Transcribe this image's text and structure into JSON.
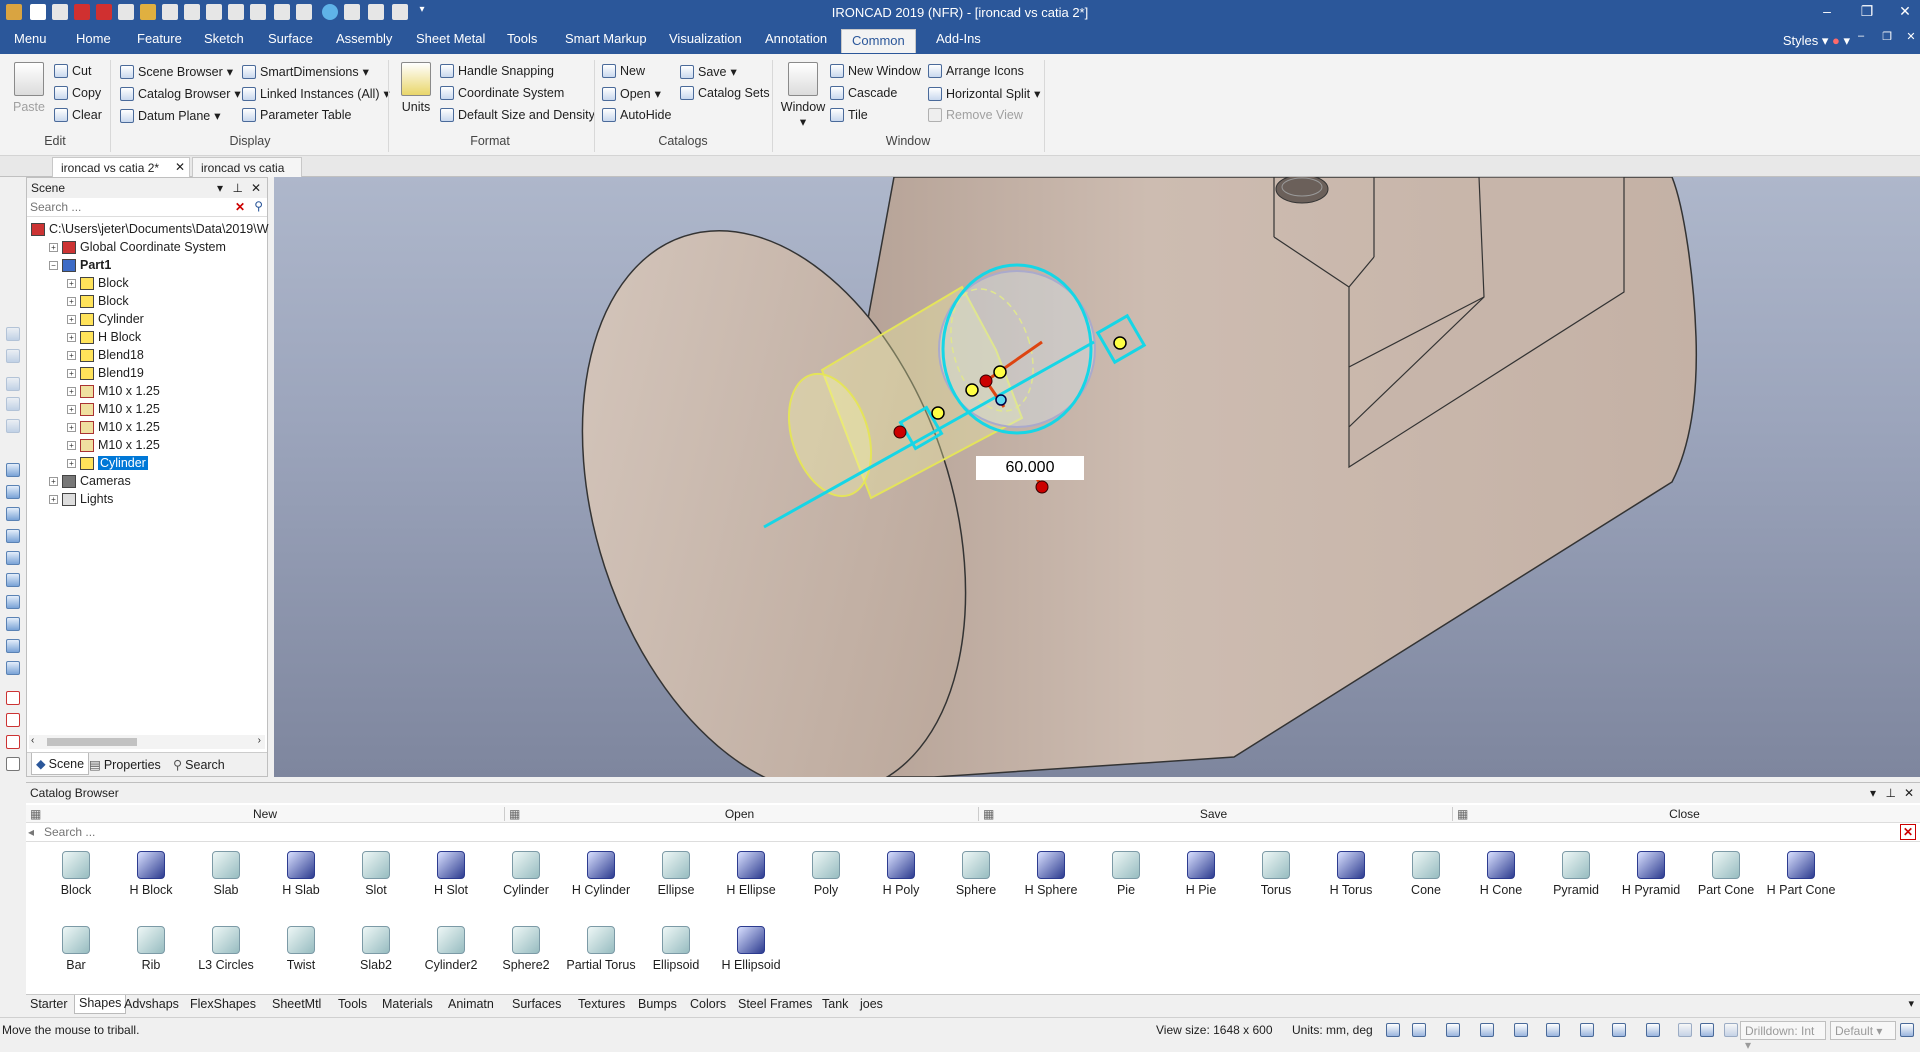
{
  "window": {
    "title": "IRONCAD 2019 (NFR) - [ironcad vs catia 2*]"
  },
  "menu_tabs": [
    "Menu",
    "Home",
    "Feature",
    "Sketch",
    "Surface",
    "Assembly",
    "Sheet Metal",
    "Tools",
    "Smart Markup",
    "Visualization",
    "Annotation",
    "Common",
    "Add-Ins"
  ],
  "active_tab": "Common",
  "styles_label": "Styles",
  "ribbon": {
    "edit": {
      "paste": "Paste",
      "cut": "Cut",
      "copy": "Copy",
      "clear": "Clear",
      "group": "Edit"
    },
    "display": {
      "scene_browser": "Scene Browser",
      "catalog_browser": "Catalog Browser",
      "datum_plane": "Datum Plane",
      "smart_dimensions": "SmartDimensions",
      "linked_instances": "Linked Instances (All)",
      "parameter_table": "Parameter Table",
      "group": "Display"
    },
    "format": {
      "units": "Units",
      "handle_snapping": "Handle Snapping",
      "coordinate_system": "Coordinate System",
      "default_size": "Default Size and Density",
      "group": "Format"
    },
    "catalogs": {
      "new": "New",
      "open": "Open",
      "autohide": "AutoHide",
      "save": "Save",
      "catalog_sets": "Catalog Sets",
      "group": "Catalogs"
    },
    "window": {
      "window": "Window",
      "new_window": "New Window",
      "cascade": "Cascade",
      "tile": "Tile",
      "arrange_icons": "Arrange Icons",
      "horizontal_split": "Horizontal Split",
      "remove_view": "Remove View",
      "group": "Window"
    }
  },
  "doc_tabs": [
    "ironcad vs catia 2*",
    "ironcad vs catia"
  ],
  "scene": {
    "title": "Scene",
    "search_placeholder": "Search ...",
    "tree": [
      {
        "label": "C:\\Users\\jeter\\Documents\\Data\\2019\\W",
        "depth": 0,
        "icon": "gl"
      },
      {
        "label": "Global Coordinate System",
        "depth": 1,
        "icon": "gl"
      },
      {
        "label": "Part1",
        "depth": 1,
        "icon": "pt"
      },
      {
        "label": "Block",
        "depth": 2,
        "icon": "b"
      },
      {
        "label": "Block",
        "depth": 2,
        "icon": "b"
      },
      {
        "label": "Cylinder",
        "depth": 2,
        "icon": "b"
      },
      {
        "label": "H Block",
        "depth": 2,
        "icon": "b"
      },
      {
        "label": "Blend18",
        "depth": 2,
        "icon": "b"
      },
      {
        "label": "Blend19",
        "depth": 2,
        "icon": "b"
      },
      {
        "label": "M10 x 1.25",
        "depth": 2,
        "icon": "th"
      },
      {
        "label": "M10 x 1.25",
        "depth": 2,
        "icon": "th"
      },
      {
        "label": "M10 x 1.25",
        "depth": 2,
        "icon": "th"
      },
      {
        "label": "M10 x 1.25",
        "depth": 2,
        "icon": "th"
      },
      {
        "label": "Cylinder",
        "depth": 2,
        "icon": "b",
        "selected": true
      },
      {
        "label": "Cameras",
        "depth": 1,
        "icon": "cam"
      },
      {
        "label": "Lights",
        "depth": 1,
        "icon": "lt"
      }
    ],
    "tabs": [
      "Scene",
      "Properties",
      "Search"
    ]
  },
  "viewport": {
    "dimension_value": "60.000"
  },
  "catalog": {
    "title": "Catalog Browser",
    "buttons": [
      "New",
      "Open",
      "Save",
      "Close"
    ],
    "search_placeholder": "Search ...",
    "shapes": [
      "Block",
      "H Block",
      "Slab",
      "H Slab",
      "Slot",
      "H Slot",
      "Cylinder",
      "H Cylinder",
      "Ellipse",
      "H Ellipse",
      "Poly",
      "H Poly",
      "Sphere",
      "H Sphere",
      "Pie",
      "H Pie",
      "Torus",
      "H Torus",
      "Cone",
      "H Cone",
      "Pyramid",
      "H Pyramid",
      "Part Cone",
      "H Part Cone",
      "Bar",
      "Rib",
      "L3 Circles",
      "Twist",
      "Slab2",
      "Cylinder2",
      "Sphere2",
      "Partial Torus",
      "Ellipsoid",
      "H Ellipsoid"
    ],
    "tabs": [
      "Starter",
      "Shapes",
      "Advshaps",
      "FlexShapes",
      "SheetMtl",
      "Tools",
      "Materials",
      "Animatn",
      "Surfaces",
      "Textures",
      "Bumps",
      "Colors",
      "Steel Frames",
      "Tank",
      "joes"
    ],
    "active_tab": "Shapes"
  },
  "status": {
    "message": "Move the mouse to triball.",
    "view_size": "View size: 1648 x 600",
    "units": "Units: mm, deg",
    "drilldown": "Drilldown: Int",
    "default": "Default"
  }
}
